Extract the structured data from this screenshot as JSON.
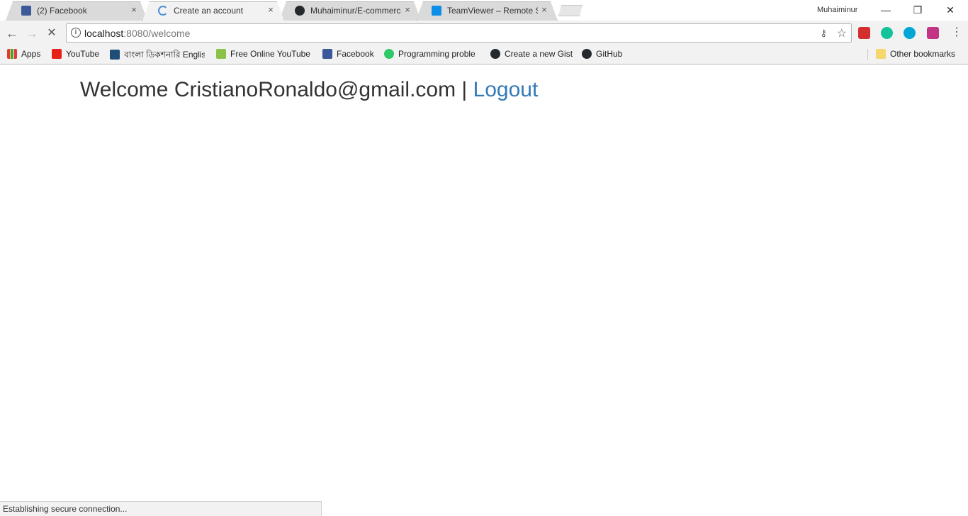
{
  "browser": {
    "tabs": [
      {
        "title": "(2) Facebook",
        "favicon": "facebook-icon",
        "close": "×"
      },
      {
        "title": "Create an account",
        "favicon": "loading-spinner-icon",
        "close": "×"
      },
      {
        "title": "Muhaiminur/E-commerce",
        "favicon": "github-icon",
        "close": "×"
      },
      {
        "title": "TeamViewer – Remote Su",
        "favicon": "teamviewer-icon",
        "close": "×"
      }
    ],
    "profile_name": "Muhaiminur",
    "window_controls": {
      "minimize": "—",
      "restore": "❐",
      "close": "✕"
    }
  },
  "toolbar": {
    "back": "←",
    "forward": "→",
    "stop": "✕",
    "url_host": "localhost",
    "url_rest": ":8080/welcome",
    "info_icon": "i",
    "key_icon": "⚷",
    "star_icon": "☆",
    "menu": "⋮"
  },
  "bookmarks": {
    "items": [
      {
        "label": "Apps"
      },
      {
        "label": "YouTube"
      },
      {
        "label": "বাংলা ডিকশনারি English"
      },
      {
        "label": "Free Online YouTube"
      },
      {
        "label": "Facebook"
      },
      {
        "label": "Programming proble"
      },
      {
        "label": "Create a new Gist"
      },
      {
        "label": "GitHub"
      }
    ],
    "other": "Other bookmarks"
  },
  "page": {
    "welcome_text": "Welcome CristianoRonaldo@gmail.com | ",
    "logout_link": "Logout"
  },
  "status": {
    "text": "Establishing secure connection..."
  }
}
